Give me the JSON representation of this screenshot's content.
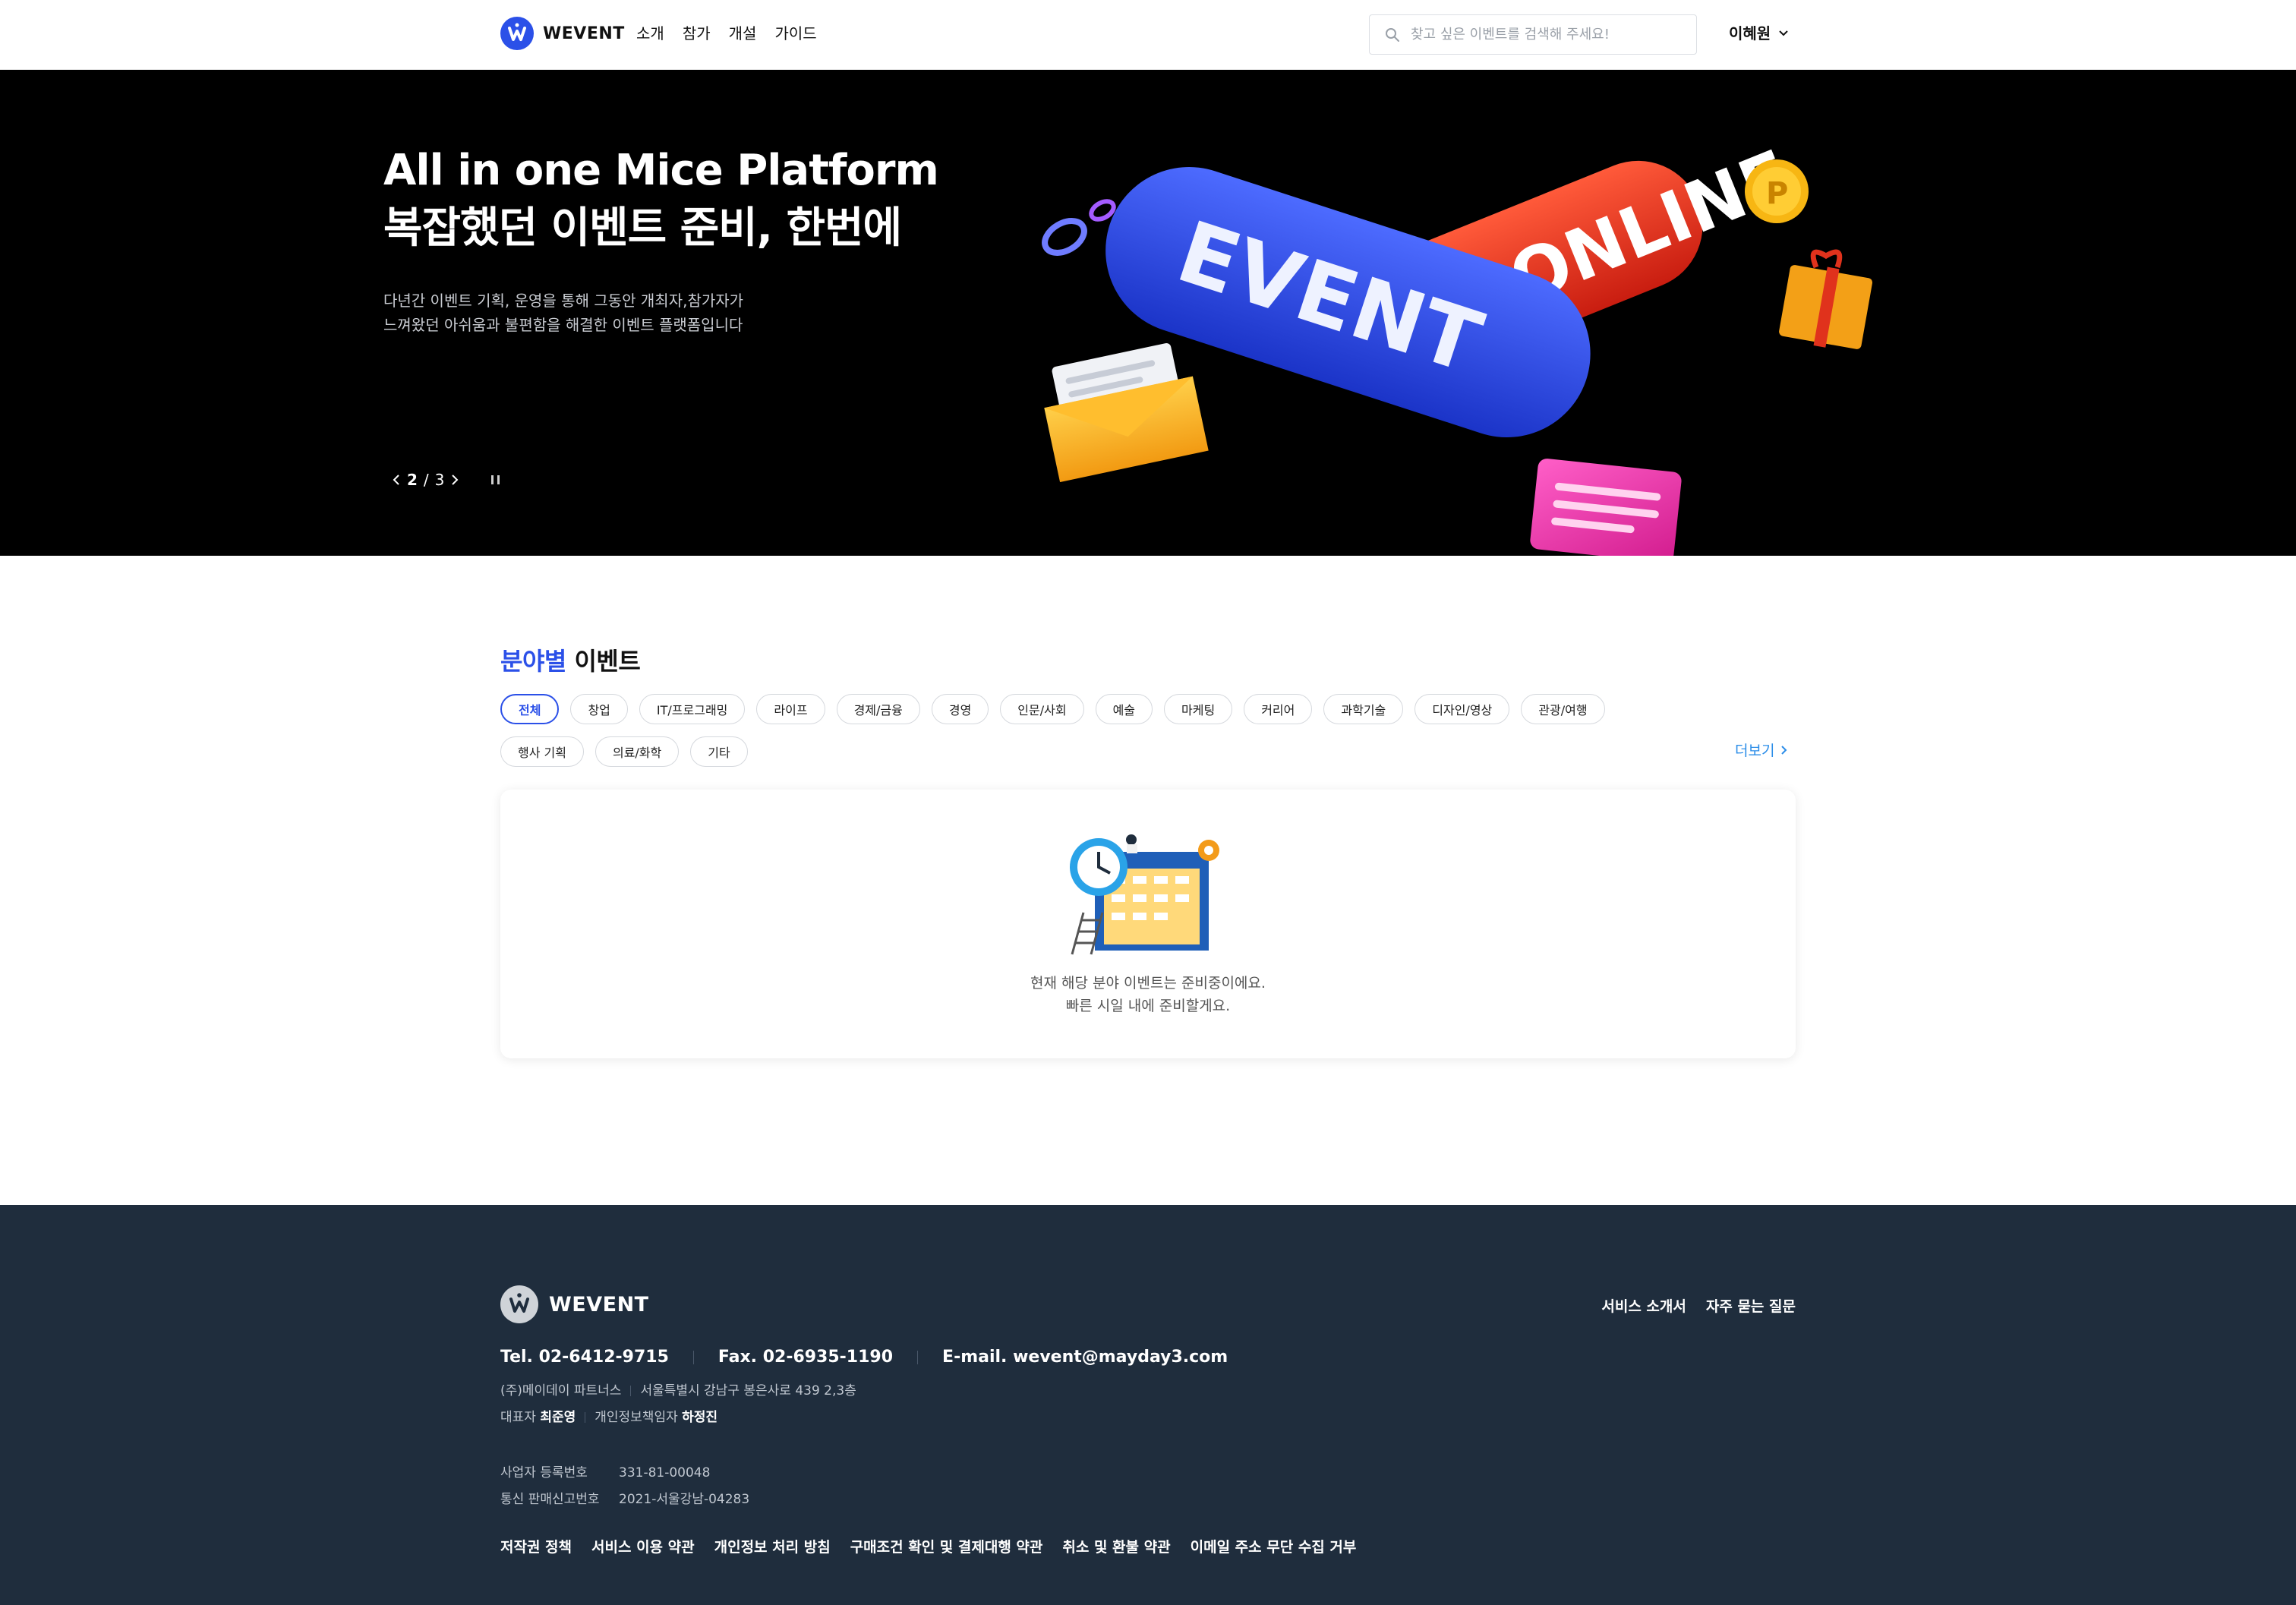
{
  "header": {
    "logo_text": "WEVENT",
    "nav": [
      "소개",
      "참가",
      "개설",
      "가이드"
    ],
    "search_placeholder": "찾고 싶은 이벤트를 검색해 주세요!",
    "user_name": "이혜원"
  },
  "hero": {
    "title_line1": "All in one Mice Platform",
    "title_line2": "복잡했던 이벤트 준비, 한번에",
    "desc_line1": "다년간 이벤트 기획, 운영을 통해 그동안 개최자,참가자가",
    "desc_line2": "느껴왔던 아쉬움과 불편함을 해결한 이벤트 플랫폼입니다",
    "slide_current": "2",
    "slide_sep": "/",
    "slide_total": "3",
    "art_word1": "EVENT",
    "art_word2": "ONLINE",
    "art_coin": "P"
  },
  "category": {
    "title_accent": "분야별",
    "title_rest": " 이벤트",
    "chips": [
      "전체",
      "창업",
      "IT/프로그래밍",
      "라이프",
      "경제/금융",
      "경영",
      "인문/사회",
      "예술",
      "마케팅",
      "커리어",
      "과학기술",
      "디자인/영상",
      "관광/여행",
      "행사 기획",
      "의료/화학",
      "기타"
    ],
    "more_label": "더보기",
    "empty_line1": "현재 해당 분야 이벤트는 준비중이에요.",
    "empty_line2": "빠른 시일 내에 준비할게요."
  },
  "footer": {
    "logo_text": "WEVENT",
    "links": [
      "서비스 소개서",
      "자주 묻는 질문"
    ],
    "tel": "Tel. 02-6412-9715",
    "fax": "Fax. 02-6935-1190",
    "email": "E-mail. wevent@mayday3.com",
    "company": "(주)메이데이 파트너스",
    "address": "서울특별시 강남구 봉은사로 439 2,3층",
    "ceo_label": "대표자",
    "ceo_name": "최준영",
    "privacy_label": "개인정보책임자",
    "privacy_name": "하정진",
    "biz_label": "사업자 등록번호",
    "biz_no": "331-81-00048",
    "telecom_label": "통신 판매신고번호",
    "telecom_no": "2021-서울강남-04283",
    "policies": [
      "저작권 정책",
      "서비스 이용 약관",
      "개인정보 처리 방침",
      "구매조건 확인 및 결제대행 약관",
      "취소 및 환불 약관",
      "이메일 주소 무단 수집 거부"
    ]
  },
  "colors": {
    "brand": "#2b50e8",
    "footer_bg": "#1f2d3d",
    "more_link": "#2b8de8"
  }
}
